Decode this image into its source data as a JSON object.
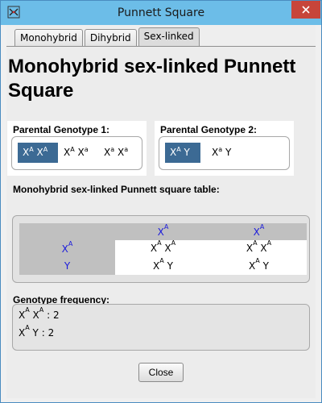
{
  "window": {
    "title": "Punnett Square",
    "close_icon": "close-icon",
    "app_icon": "punnett-app-icon"
  },
  "tabs": [
    {
      "label": "Monohybrid",
      "active": false
    },
    {
      "label": "Dihybrid",
      "active": false
    },
    {
      "label": "Sex-linked",
      "active": true
    }
  ],
  "heading": "Monohybrid sex-linked Punnett Square",
  "parent1": {
    "label": "Parental Genotype 1:",
    "options": [
      {
        "a1": "X",
        "s1": "A",
        "a2": "X",
        "s2": "A",
        "selected": true
      },
      {
        "a1": "X",
        "s1": "A",
        "a2": "X",
        "s2": "a",
        "selected": false
      },
      {
        "a1": "X",
        "s1": "a",
        "a2": "X",
        "s2": "a",
        "selected": false
      }
    ]
  },
  "parent2": {
    "label": "Parental Genotype 2:",
    "options": [
      {
        "a1": "X",
        "s1": "A",
        "a2": "Y",
        "s2": "",
        "selected": true
      },
      {
        "a1": "X",
        "s1": "a",
        "a2": "Y",
        "s2": "",
        "selected": false
      }
    ]
  },
  "table": {
    "label": "Monohybrid sex-linked Punnett square table:",
    "col_headers": [
      {
        "b": "X",
        "s": "A"
      },
      {
        "b": "X",
        "s": "A"
      }
    ],
    "row_headers": [
      {
        "b": "X",
        "s": "A"
      },
      {
        "b": "Y",
        "s": ""
      }
    ],
    "cells": [
      [
        {
          "a1": "X",
          "s1": "A",
          "a2": "X",
          "s2": "A"
        },
        {
          "a1": "X",
          "s1": "A",
          "a2": "X",
          "s2": "A"
        }
      ],
      [
        {
          "a1": "X",
          "s1": "A",
          "a2": "Y",
          "s2": ""
        },
        {
          "a1": "X",
          "s1": "A",
          "a2": "Y",
          "s2": ""
        }
      ]
    ]
  },
  "frequency": {
    "label": "Genotype frequency:",
    "lines": [
      {
        "a1": "X",
        "s1": "A",
        "a2": "X",
        "s2": "A",
        "count": ": 2"
      },
      {
        "a1": "X",
        "s1": "A",
        "a2": "Y",
        "s2": "",
        "count": ": 2"
      }
    ]
  },
  "buttons": {
    "close": "Close"
  },
  "colors": {
    "title_bar": "#6cbde8",
    "close_button": "#c7453a",
    "selection": "#3c6a94",
    "allele_blue": "#1a1adc"
  }
}
